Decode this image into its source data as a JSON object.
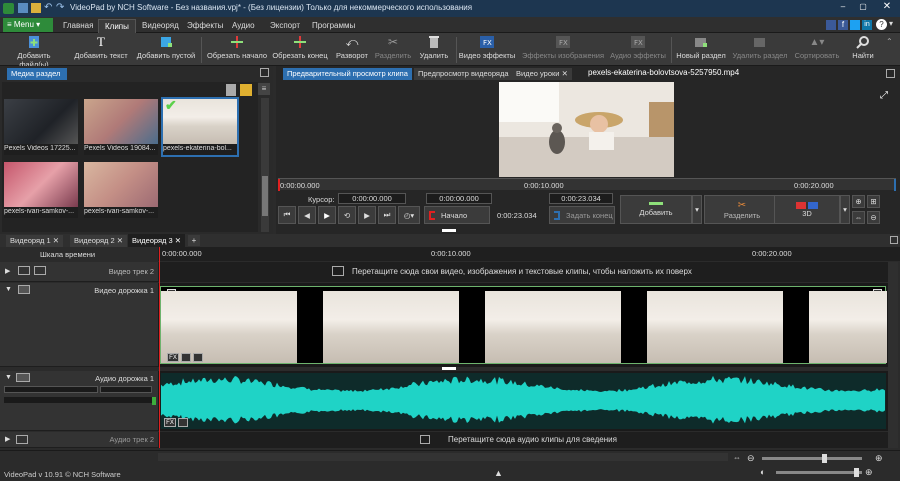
{
  "window": {
    "title": "VideoPad by NCH Software - Без названия.vpj* - (Без лицензии) Только для некоммерческого использования"
  },
  "menu": {
    "menu_label": "Menu",
    "tabs": [
      "Главная",
      "Клипы",
      "Видеоряд",
      "Эффекты",
      "Аудио",
      "Экспорт",
      "Программы"
    ],
    "active_tab": "Клипы"
  },
  "toolbar": [
    {
      "label": "Добавить файл(ы)",
      "icon": "add-file-icon",
      "enabled": true
    },
    {
      "label": "Добавить текст",
      "icon": "add-text-icon",
      "enabled": true
    },
    {
      "label": "Добавить пустой",
      "icon": "add-blank-icon",
      "enabled": true
    },
    {
      "label": "Обрезать начало",
      "icon": "trim-start-icon",
      "enabled": true
    },
    {
      "label": "Обрезать конец",
      "icon": "trim-end-icon",
      "enabled": true
    },
    {
      "label": "Разворот",
      "icon": "reverse-icon",
      "enabled": true
    },
    {
      "label": "Разделить",
      "icon": "split-icon",
      "enabled": false
    },
    {
      "label": "Удалить",
      "icon": "delete-icon",
      "enabled": true
    },
    {
      "label": "Видео эффекты",
      "icon": "video-fx-icon",
      "enabled": true
    },
    {
      "label": "Эффекты изображения",
      "icon": "image-fx-icon",
      "enabled": false
    },
    {
      "label": "Аудио эффекты",
      "icon": "audio-fx-icon",
      "enabled": false
    },
    {
      "label": "Новый раздел",
      "icon": "new-section-icon",
      "enabled": true
    },
    {
      "label": "Удалить раздел",
      "icon": "delete-section-icon",
      "enabled": false
    },
    {
      "label": "Сортировать",
      "icon": "sort-icon",
      "enabled": false
    },
    {
      "label": "Найти",
      "icon": "search-icon",
      "enabled": true
    }
  ],
  "media": {
    "tab_label": "Медиа раздел",
    "items": [
      {
        "name": "Pexels Videos 17225...",
        "selected": false
      },
      {
        "name": "Pexels Videos 19084...",
        "selected": false
      },
      {
        "name": "pexels-ekaterina-bol...",
        "selected": true
      },
      {
        "name": "pexels-ivan-samkov-...",
        "selected": false
      },
      {
        "name": "pexels-ivan-samkov-...",
        "selected": false
      }
    ]
  },
  "preview": {
    "tabs": [
      "Предварительный просмотр клипа",
      "Предпросмотр видеоряда",
      "Видео уроки"
    ],
    "filename": "pexels-ekaterina-bolovtsova-5257950.mp4",
    "ruler": [
      "0:00:00.000",
      "0:00:10.000",
      "0:00:20.000"
    ],
    "cursor_label": "Курсор:",
    "cursor_value": "0:00:00.000",
    "start_value": "0:00:00.000",
    "end_value": "0:00:23.034",
    "duration": "0:00:23.034",
    "start_button": "Начало",
    "end_button": "Задать конец",
    "add_button": "Добавить",
    "split_button": "Разделить",
    "mode_3d": "3D"
  },
  "sequences": {
    "tabs": [
      "Видеоряд 1",
      "Видеоряд 2",
      "Видеоряд 3"
    ],
    "active": "Видеоряд 3"
  },
  "timeline": {
    "scale_label": "Шкала времени",
    "ruler": [
      "0:00:00.000",
      "0:00:10.000",
      "0:00:20.000"
    ],
    "tracks": {
      "video2": {
        "name": "Видео трек 2",
        "hint": "Перетащите сюда свои видео, изображения и текстовые клипы, чтобы наложить их поверх"
      },
      "video1": {
        "name": "Видео дорожка 1"
      },
      "audio1": {
        "name": "Аудио дорожка 1"
      },
      "audio2": {
        "name": "Аудио трек 2",
        "hint": "Перетащите сюда аудио клипы для сведения"
      }
    }
  },
  "status": {
    "text": "VideoPad v 10.91 © NCH Software"
  },
  "colors": {
    "accent": "#2d6fb0",
    "waveform": "#1fd3c6",
    "playhead": "#e02020",
    "menu_button": "#2e8b3a"
  }
}
